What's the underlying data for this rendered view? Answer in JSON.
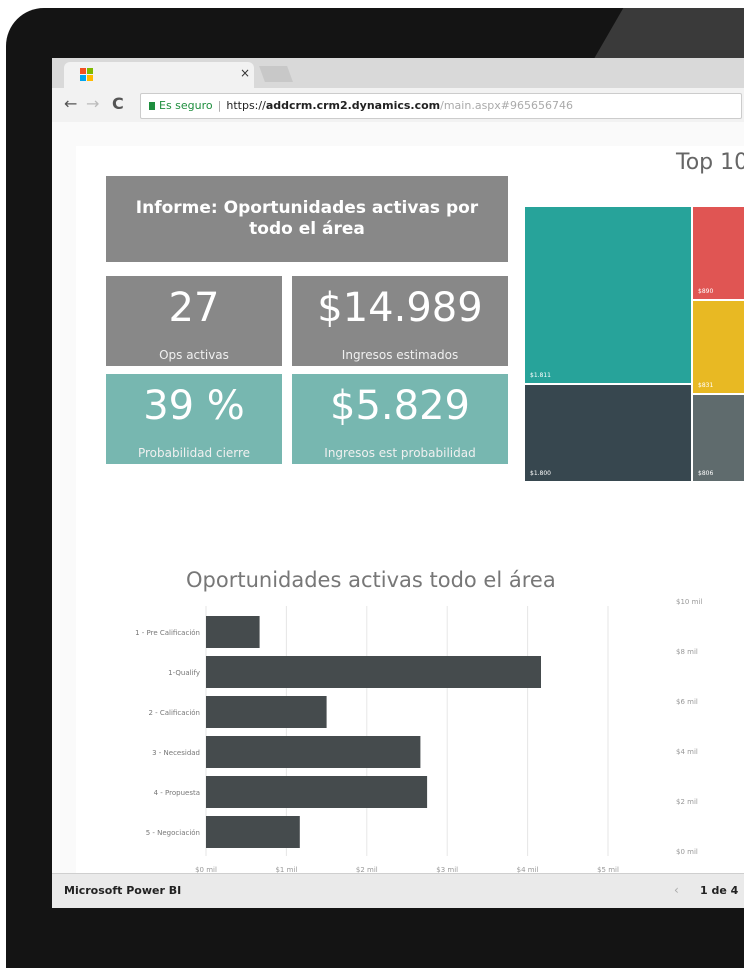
{
  "browser": {
    "tab_close": "×",
    "nav_back": "←",
    "nav_forward": "→",
    "nav_reload": "C",
    "secure_label": "Es seguro",
    "url_scheme": "https://",
    "url_host": "addcrm.crm2.dynamics.com",
    "url_path": "/main.aspx#965656746"
  },
  "report": {
    "title": "Informe: Oportunidades activas por todo el área",
    "kpis": [
      {
        "value": "27",
        "label": "Ops activas"
      },
      {
        "value": "$14.989",
        "label": "Ingresos estimados"
      },
      {
        "value": "39 %",
        "label": "Probabilidad cierre"
      },
      {
        "value": "$5.829",
        "label": "Ingresos est probabilidad"
      }
    ]
  },
  "treemap": {
    "title": "Top 10",
    "cells": [
      {
        "label": "$1.811",
        "color": "#27a39a"
      },
      {
        "label": "$1.800",
        "color": "#37474f"
      },
      {
        "label": "$890",
        "color": "#e05553"
      },
      {
        "label": "$831",
        "color": "#e8b923"
      },
      {
        "label": "$806",
        "color": "#5f6b6d"
      }
    ]
  },
  "chart_data": {
    "type": "bar",
    "orientation": "horizontal",
    "title": "Oportunidades activas todo el área",
    "categories": [
      "1 - Pre Calificación",
      "1-Qualify",
      "2 - Calificación",
      "3 - Necesidad",
      "4 - Propuesta",
      "5 - Negociación"
    ],
    "values": [
      0.4,
      2.5,
      0.9,
      1.6,
      1.65,
      0.7
    ],
    "x_ticks": [
      "$0 mil",
      "$1 mil",
      "$2 mil",
      "$3 mil",
      "$4 mil",
      "$5 mil"
    ],
    "xlim": [
      0,
      3
    ],
    "bar_color": "#454b4d",
    "grid": true,
    "right_axis_ticks": [
      "$10 mil",
      "$8 mil",
      "$6 mil",
      "$4 mil",
      "$2 mil",
      "$0 mil"
    ]
  },
  "statusbar": {
    "brand": "Microsoft Power BI",
    "prev": "‹",
    "page": "1 de 4"
  }
}
